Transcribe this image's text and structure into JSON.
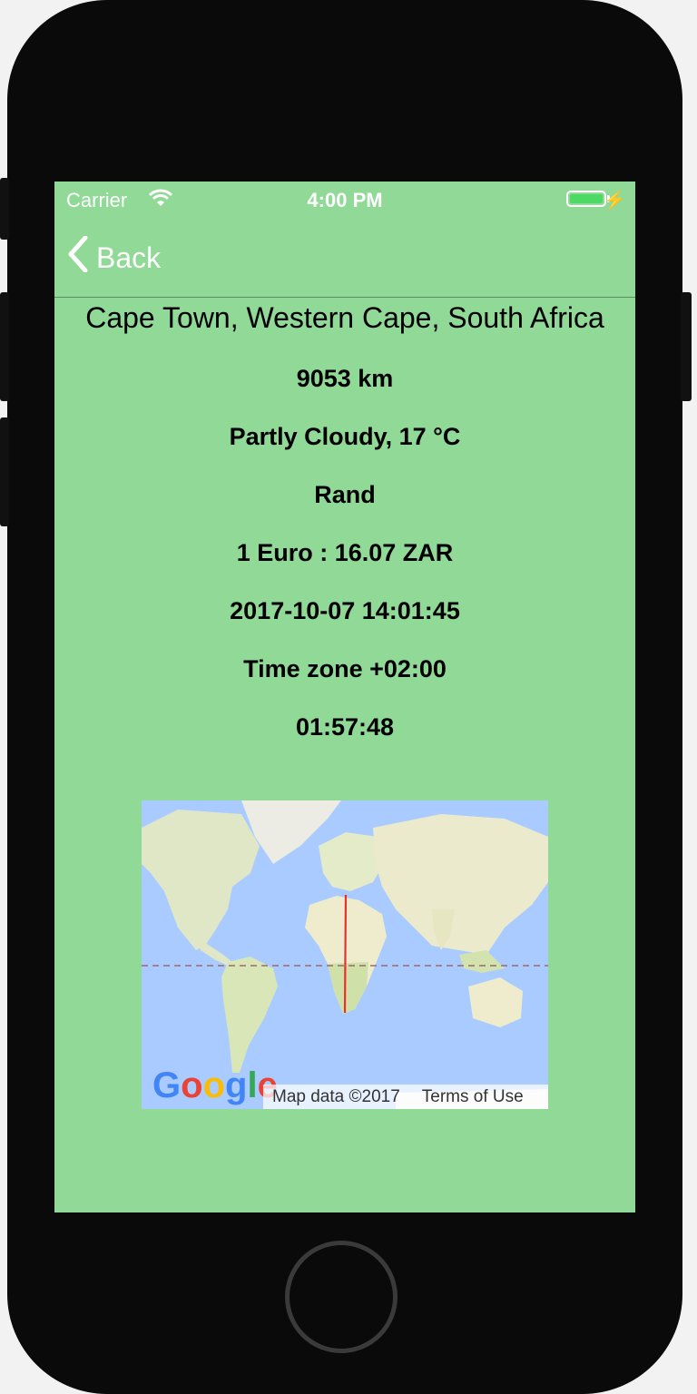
{
  "status_bar": {
    "carrier": "Carrier",
    "time": "4:00 PM",
    "battery_color": "#4cd964"
  },
  "nav": {
    "back_label": "Back"
  },
  "details": {
    "location": "Cape Town, Western Cape, South Africa",
    "distance": "9053 km",
    "weather": "Partly Cloudy, 17 °C",
    "currency": "Rand",
    "exchange_rate": "1 Euro : 16.07 ZAR",
    "datetime": "2017-10-07 14:01:45",
    "timezone": "Time zone +02:00",
    "time_difference": "01:57:48"
  },
  "map": {
    "logo": "Google",
    "map_data": "Map data ©2017",
    "terms": "Terms of Use",
    "colors": {
      "ocean": "#aacbff",
      "land": "#eeeccd",
      "route": "#e8312f",
      "equator": "#9a6b6b"
    }
  },
  "theme": {
    "background": "#90d996"
  }
}
